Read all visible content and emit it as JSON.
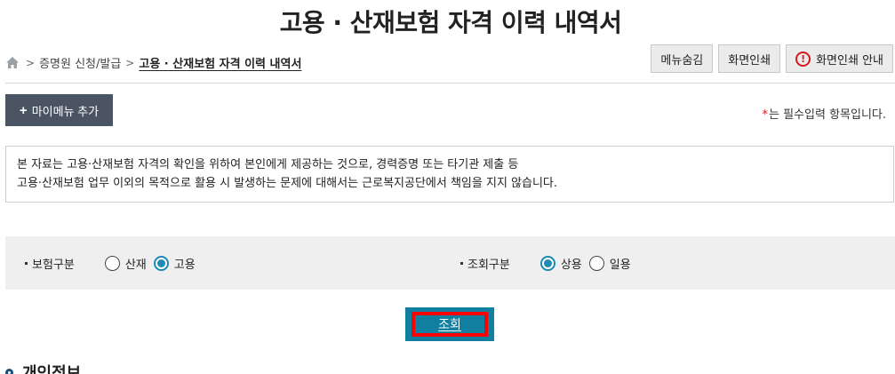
{
  "page": {
    "title": "고용 · 산재보험 자격 이력 내역서"
  },
  "breadcrumb": {
    "items": [
      "증명원 신청/발급",
      "고용 · 산재보험 자격 이력 내역서"
    ],
    "separator": ">"
  },
  "util": {
    "hide_menu": "메뉴숨김",
    "print": "화면인쇄",
    "print_guide": "화면인쇄 안내"
  },
  "mymenu": {
    "plus": "+",
    "label": "마이메뉴 추가"
  },
  "required_note": {
    "star": "*",
    "text": "는 필수입력 항목입니다."
  },
  "notice": {
    "line1": "본 자료는 고용·산재보험 자격의 확인을 위하여 본인에게 제공하는 것으로, 경력증명 또는 타기관 제출 등",
    "line2": "고용·산재보험 업무 이외의 목적으로 활용 시 발생하는 문제에 대해서는 근로복지공단에서 책임을 지지 않습니다."
  },
  "filters": {
    "insurance_type": {
      "label": "보험구분",
      "options": [
        {
          "label": "산재",
          "checked": false
        },
        {
          "label": "고용",
          "checked": true
        }
      ]
    },
    "query_type": {
      "label": "조회구분",
      "options": [
        {
          "label": "상용",
          "checked": true
        },
        {
          "label": "일용",
          "checked": false
        }
      ]
    }
  },
  "search_button": {
    "label": "조회"
  },
  "section": {
    "title": "개인정보"
  },
  "colors": {
    "primary": "#117f9f",
    "radio_checked": "#1b8ab5",
    "mymenu_bg": "#4b5463",
    "highlight": "#ff0000",
    "required": "#d71920"
  },
  "icons": [
    "home-icon",
    "warning-icon",
    "plus-icon"
  ]
}
